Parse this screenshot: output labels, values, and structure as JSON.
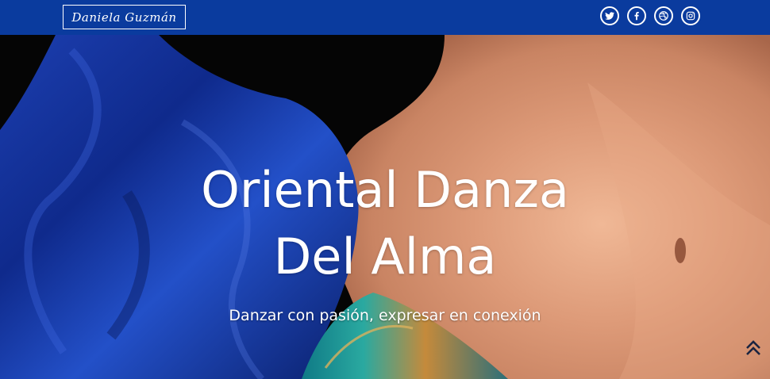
{
  "header": {
    "logo_text": "Daniela Guzmán",
    "social": [
      "twitter-icon",
      "facebook-icon",
      "dribbble-icon",
      "instagram-icon"
    ],
    "background_color": "#0a3b9e"
  },
  "hero": {
    "title_line1": "Oriental Danza",
    "title_line2": "Del Alma",
    "subtitle": "Danzar con pasión, expresar en conexión"
  },
  "scroll_top_icon": "double-chevron-up-icon"
}
